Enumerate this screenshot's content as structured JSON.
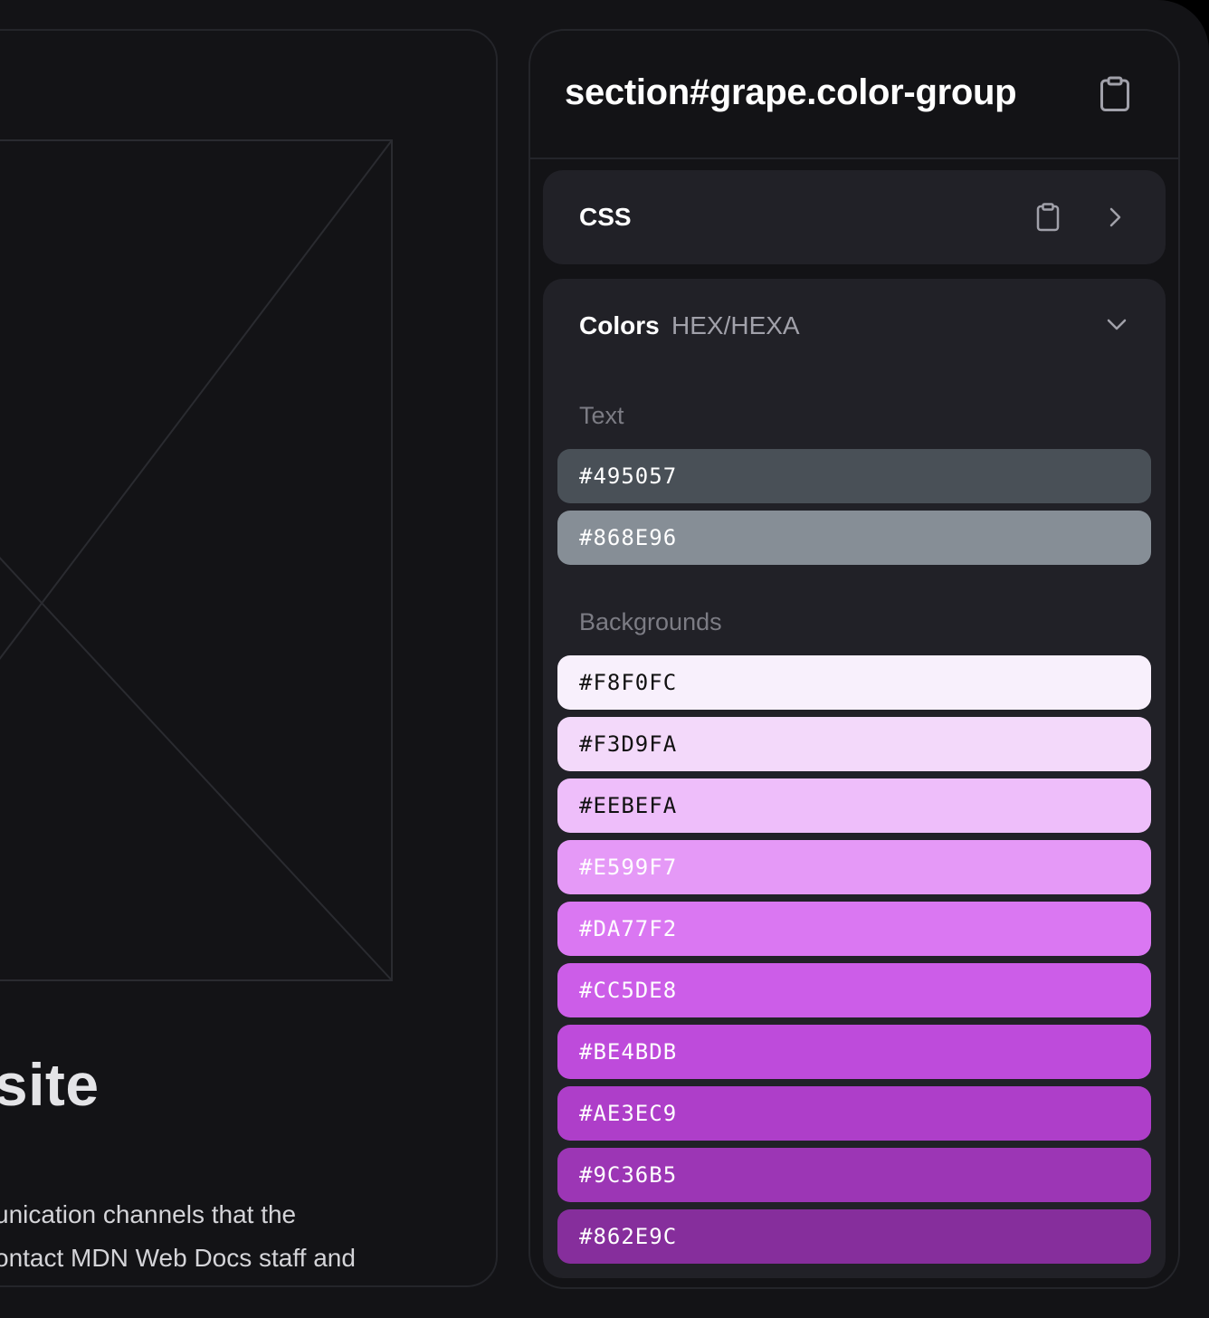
{
  "preview": {
    "heading": "website",
    "lines": [
      "unication channels that the",
      "ontact MDN Web Docs staff and"
    ]
  },
  "inspector": {
    "title": "section#grape.color-group",
    "css_label": "CSS",
    "colors": {
      "title": "Colors",
      "format": "HEX/HEXA",
      "text_label": "Text",
      "backgrounds_label": "Backgrounds",
      "text": [
        {
          "hex": "#495057",
          "color": "#495057",
          "text_color": "#ffffff"
        },
        {
          "hex": "#868E96",
          "color": "#868E96",
          "text_color": "#ffffff"
        }
      ],
      "backgrounds": [
        {
          "hex": "#F8F0FC",
          "color": "#F8F0FC",
          "text_color": "#111111"
        },
        {
          "hex": "#F3D9FA",
          "color": "#F3D9FA",
          "text_color": "#111111"
        },
        {
          "hex": "#EEBEFA",
          "color": "#EEBEFA",
          "text_color": "#111111"
        },
        {
          "hex": "#E599F7",
          "color": "#E599F7",
          "text_color": "#ffffff"
        },
        {
          "hex": "#DA77F2",
          "color": "#DA77F2",
          "text_color": "#ffffff"
        },
        {
          "hex": "#CC5DE8",
          "color": "#CC5DE8",
          "text_color": "#ffffff"
        },
        {
          "hex": "#BE4BDB",
          "color": "#BE4BDB",
          "text_color": "#ffffff"
        },
        {
          "hex": "#AE3EC9",
          "color": "#AE3EC9",
          "text_color": "#ffffff"
        },
        {
          "hex": "#9C36B5",
          "color": "#9C36B5",
          "text_color": "#ffffff"
        },
        {
          "hex": "#862E9C",
          "color": "#862E9C",
          "text_color": "#ffffff"
        }
      ]
    }
  },
  "icons": {
    "copy": "clipboard-icon",
    "expand": "chevron-right-icon",
    "collapse": "chevron-down-icon"
  }
}
